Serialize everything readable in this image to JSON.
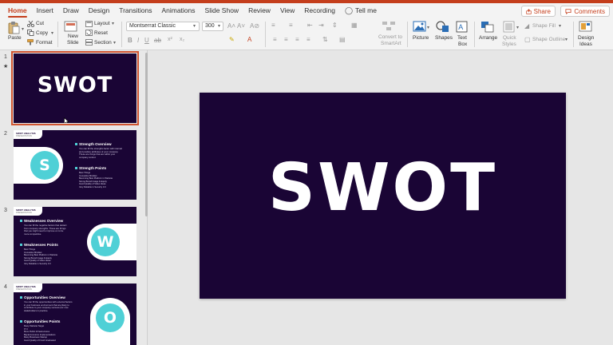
{
  "colors": {
    "accent": "#c43e1c",
    "slide_bg": "#1a0535",
    "teal": "#4fd0d6"
  },
  "tabs": [
    "Home",
    "Insert",
    "Draw",
    "Design",
    "Transitions",
    "Animations",
    "Slide Show",
    "Review",
    "View",
    "Recording"
  ],
  "tell_me": "Tell me",
  "share": "Share",
  "comments": "Comments",
  "ribbon": {
    "paste": "Paste",
    "cut": "Cut",
    "copy": "Copy",
    "format": "Format",
    "new_slide": "New",
    "new_slide2": "Slide",
    "layout": "Layout",
    "reset": "Reset",
    "section": "Section",
    "font_name": "Montserrat Classic",
    "font_size": "300",
    "convert": "Convert to",
    "smartart": "SmartArt",
    "picture": "Picture",
    "shapes": "Shapes",
    "text_box": "Text",
    "text_box2": "Box",
    "arrange": "Arrange",
    "quick_styles": "Quick",
    "quick_styles2": "Styles",
    "shape_fill": "Shape Fill",
    "shape_outline": "Shape Outline",
    "design_ideas": "Design",
    "design_ideas2": "Ideas"
  },
  "slides": [
    {
      "num": "1",
      "title": "SWOT"
    },
    {
      "num": "2",
      "tag_title": "SWOT ANALYSIS",
      "tag_sub": "PRESENTATION",
      "letter": "S",
      "h1": "Strength Overview",
      "p1": [
        "You can fill the strengths factor with internal",
        "and positive attributes of your company.",
        "These are things that are within your",
        "company control."
      ],
      "h2": "Strength Points",
      "b2": [
        "Best Things",
        "Innovative Mindset",
        "Becoming Best Platform in Website",
        "Strong Brand Image & Equity",
        "Good Quality of Video Ideas",
        "Very Reliable in Security 3.0"
      ]
    },
    {
      "num": "3",
      "tag_title": "SWOT ANALYSIS",
      "tag_sub": "PRESENTATION",
      "letter": "W",
      "h1": "Weaknesses Overview",
      "p1": [
        "You can fill the negative factors that detract",
        "from company strengths. These are things",
        "that you might need to improve on to be",
        "more competitive."
      ],
      "h2": "Weaknesses Points",
      "b2": [
        "Best Things",
        "Innovative Mindset",
        "Becoming Best Platform in Website",
        "Strong Brand Image & Equity",
        "Good Quality of Video Ideas",
        "Very Reliable in Security 3.0"
      ]
    },
    {
      "num": "4",
      "tag_title": "SWOT ANALYSIS",
      "tag_sub": "PRESENTATION",
      "letter": "O",
      "h1": "Opportunities Overview",
      "p1": [
        "You can fill the opportunities with external factors",
        "in your business environment that are likely to",
        "contribute to your company success (for now",
        "stakeholders in practice."
      ],
      "h2": "Opportunities Points",
      "b2": [
        "Many Website Target",
        "IT 3",
        "More Public Infrastructures",
        "Big Ecommerce Implementations",
        "Many Bussiness Startup",
        "Good Quality of Fresh Graduated"
      ]
    }
  ],
  "main_slide_title": "SWOT"
}
